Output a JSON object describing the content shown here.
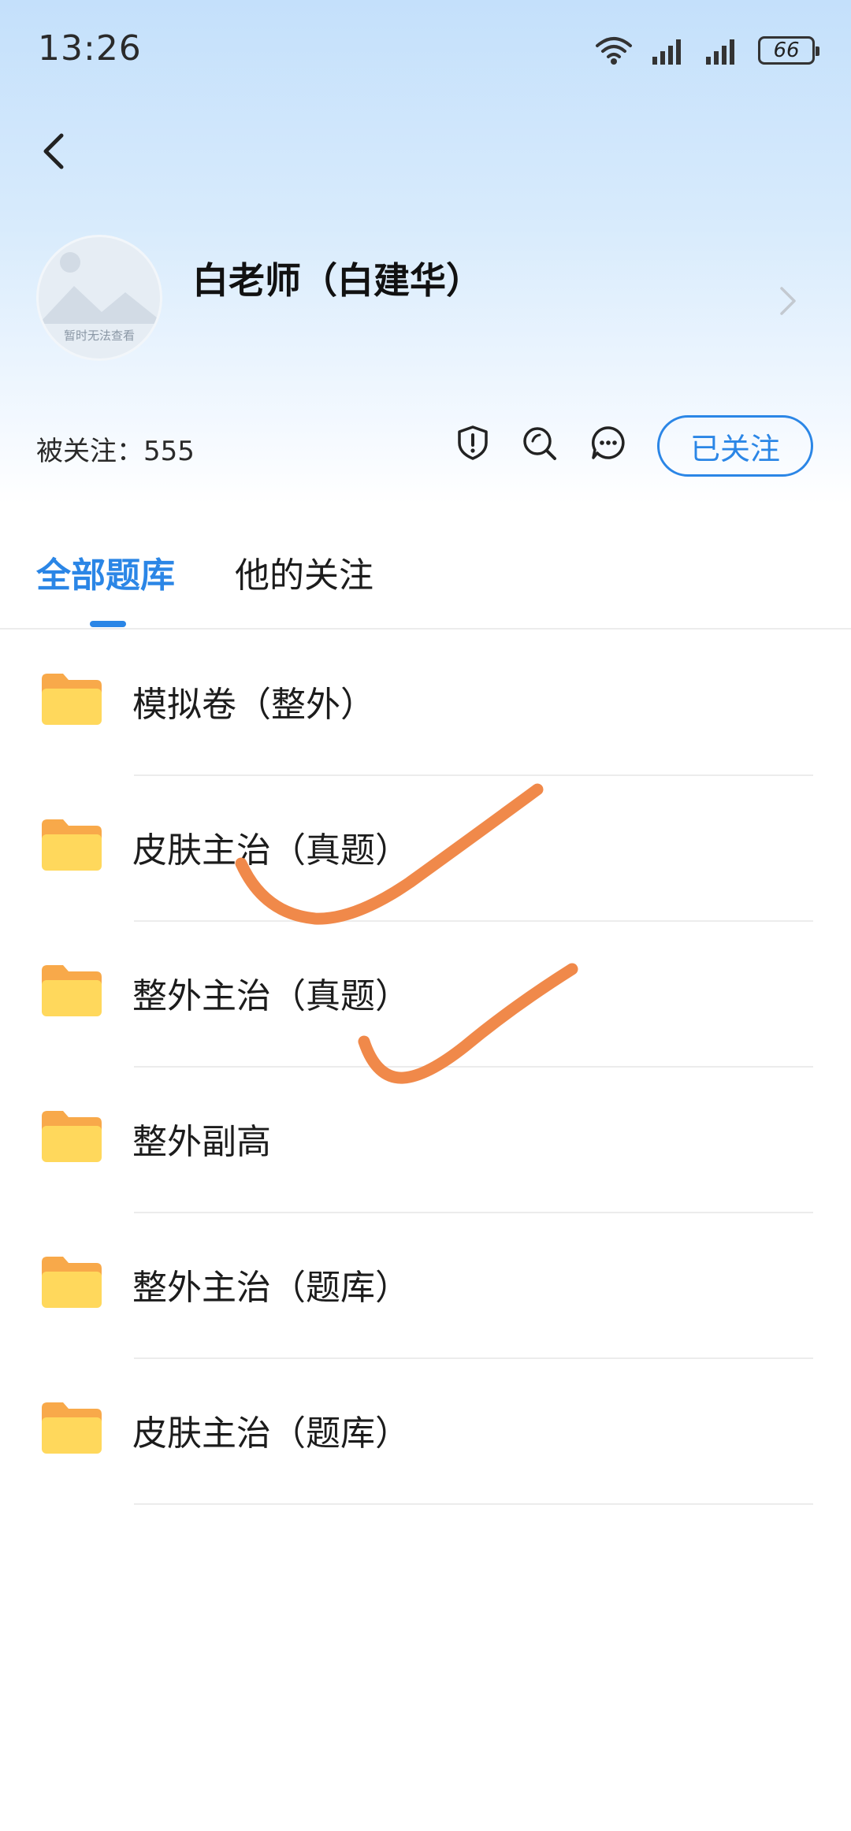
{
  "status_bar": {
    "time": "13:26",
    "battery": "66",
    "icons": [
      "wifi-icon",
      "signal-icon",
      "signal-icon",
      "battery-icon"
    ]
  },
  "profile": {
    "name": "白老师（白建华）",
    "avatar_caption": "暂时无法查看",
    "followers_label": "被关注：555"
  },
  "actions": {
    "icons": [
      "shield-alert-icon",
      "search-icon",
      "message-icon"
    ],
    "follow_label": "已关注"
  },
  "tabs": [
    {
      "label": "全部题库",
      "active": true
    },
    {
      "label": "他的关注",
      "active": false
    }
  ],
  "folders": [
    {
      "label": "模拟卷（整外）"
    },
    {
      "label": "皮肤主治（真题）",
      "checked": true
    },
    {
      "label": "整外主治（真题）",
      "checked": true
    },
    {
      "label": "整外副高"
    },
    {
      "label": "整外主治（题库）"
    },
    {
      "label": "皮肤主治（题库）"
    }
  ],
  "colors": {
    "accent": "#2b86e6",
    "folder_back": "#f8a94a",
    "folder_front": "#ffd85c",
    "annotation": "#f0894a",
    "header_gradient_top": "#c4e0fb"
  }
}
